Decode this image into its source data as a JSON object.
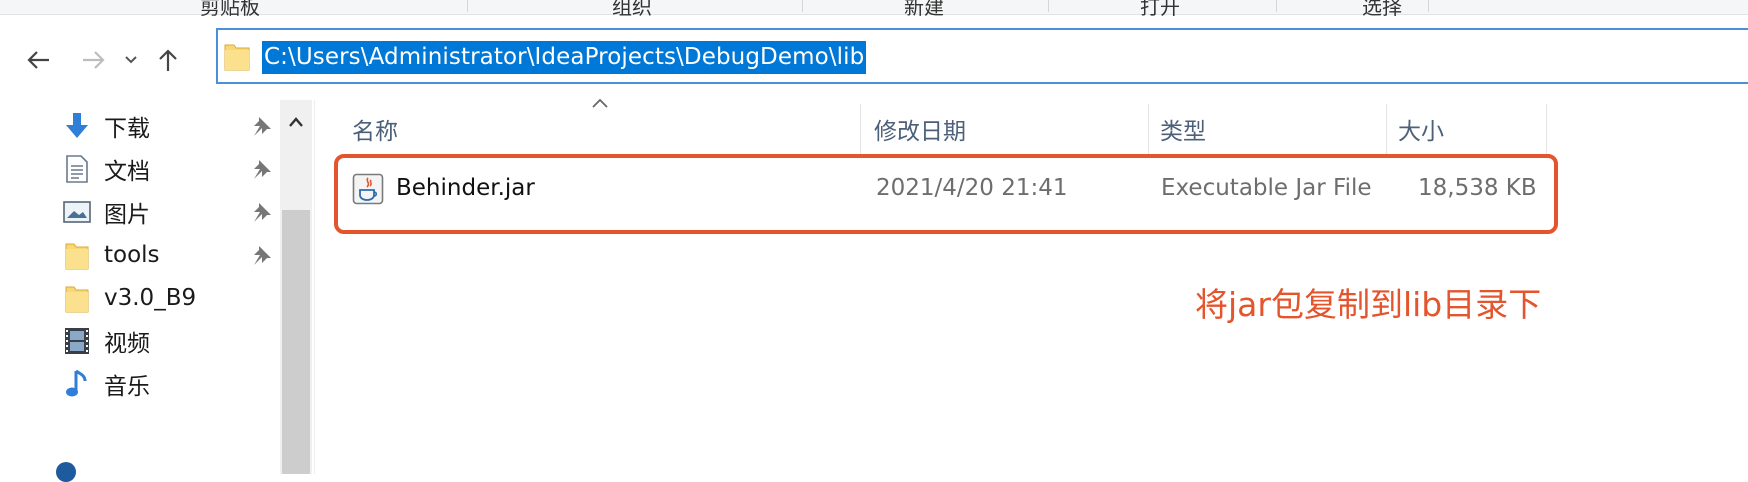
{
  "ribbon": {
    "labels": [
      "剪贴板",
      "组织",
      "新建",
      "打开",
      "选择"
    ]
  },
  "address_bar": {
    "path": "C:\\Users\\Administrator\\IdeaProjects\\DebugDemo\\lib"
  },
  "nav_pane": {
    "items": [
      {
        "label": "下载",
        "icon": "download-arrow-icon",
        "pinned": true
      },
      {
        "label": "文档",
        "icon": "document-icon",
        "pinned": true
      },
      {
        "label": "图片",
        "icon": "pictures-icon",
        "pinned": true
      },
      {
        "label": "tools",
        "icon": "folder-icon",
        "pinned": true
      },
      {
        "label": "v3.0_B9",
        "icon": "folder-icon",
        "pinned": false
      },
      {
        "label": "视频",
        "icon": "video-icon",
        "pinned": false
      },
      {
        "label": "音乐",
        "icon": "music-icon",
        "pinned": false
      }
    ]
  },
  "columns": {
    "name": "名称",
    "modified": "修改日期",
    "type": "类型",
    "size": "大小"
  },
  "files": [
    {
      "name": "Behinder.jar",
      "modified": "2021/4/20 21:41",
      "type": "Executable Jar File",
      "size": "18,538 KB",
      "icon": "java-jar-icon"
    }
  ],
  "annotation": {
    "text": "将jar包复制到lib目录下",
    "color": "#e4552d"
  },
  "colors": {
    "selection": "#0078d7",
    "address_border": "#4a90d9",
    "header_text": "#4c607a",
    "highlight": "#e4552d"
  }
}
